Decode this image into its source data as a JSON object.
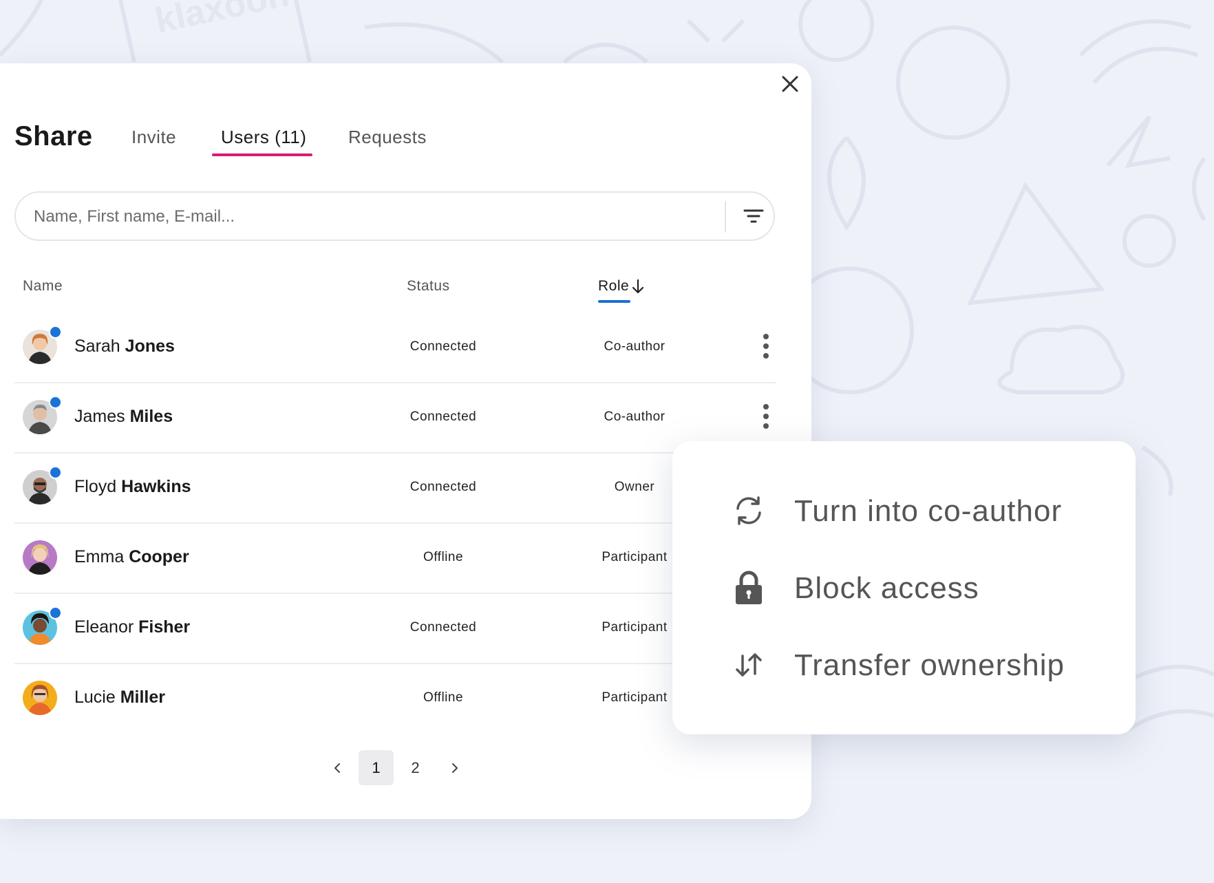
{
  "dialog": {
    "title": "Share",
    "tabs": [
      {
        "label": "Invite"
      },
      {
        "label": "Users (11)"
      },
      {
        "label": "Requests"
      }
    ],
    "active_tab": "Users (11)"
  },
  "search": {
    "placeholder": "Name, First name, E-mail...",
    "value": ""
  },
  "table": {
    "columns": {
      "name": "Name",
      "status": "Status",
      "role": "Role"
    },
    "sort_column": "Role",
    "sort_direction": "descending",
    "rows": [
      {
        "first": "Sarah",
        "last": "Jones",
        "status": "Connected",
        "role": "Co-author",
        "online": true,
        "avatar_color": "#c98a5a"
      },
      {
        "first": "James",
        "last": "Miles",
        "status": "Connected",
        "role": "Co-author",
        "online": true,
        "avatar_color": "#8e8e8e"
      },
      {
        "first": "Floyd",
        "last": "Hawkins",
        "status": "Connected",
        "role": "Owner",
        "online": true,
        "avatar_color": "#6b5a4d"
      },
      {
        "first": "Emma",
        "last": "Cooper",
        "status": "Offline",
        "role": "Participant",
        "online": false,
        "avatar_color": "#b06ac0"
      },
      {
        "first": "Eleanor",
        "last": "Fisher",
        "status": "Connected",
        "role": "Participant",
        "online": true,
        "avatar_color": "#4fb8d8"
      },
      {
        "first": "Lucie",
        "last": "Miller",
        "status": "Offline",
        "role": "Participant",
        "online": false,
        "avatar_color": "#f2a91e"
      }
    ]
  },
  "pagination": {
    "pages": [
      "1",
      "2"
    ],
    "current": "1",
    "prev_icon": "chevron-left-icon",
    "next_icon": "chevron-right-icon"
  },
  "context_menu": {
    "items": [
      {
        "label": "Turn into co-author",
        "icon": "refresh-icon"
      },
      {
        "label": "Block access",
        "icon": "lock-icon"
      },
      {
        "label": "Transfer ownership",
        "icon": "swap-arrows-icon"
      }
    ]
  },
  "background": {
    "watermark_text": "klaxoon"
  },
  "colors": {
    "accent_tab": "#d81b74",
    "accent_sort": "#1d6fd1",
    "online_dot": "#1a73d6",
    "background": "#eef1f8"
  }
}
